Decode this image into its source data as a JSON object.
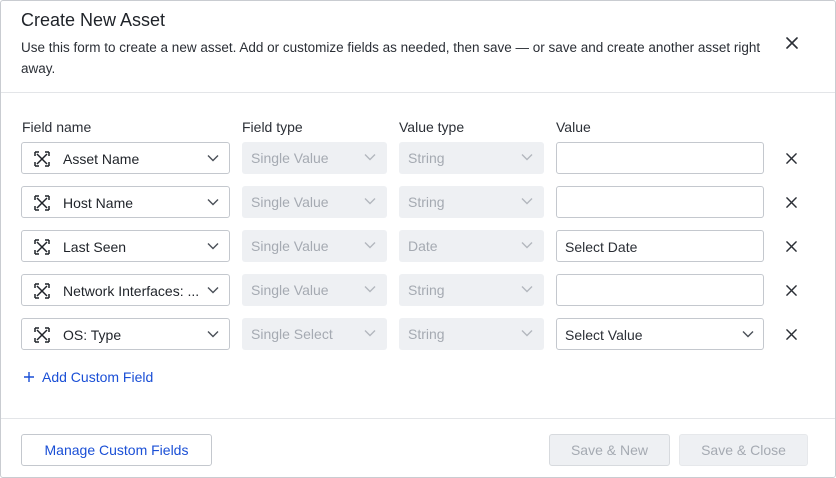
{
  "dialog": {
    "title": "Create New Asset",
    "description": "Use this form to create a new asset. Add or customize fields as needed, then save — or save and create another asset right away."
  },
  "columns": {
    "field_name": "Field name",
    "field_type": "Field type",
    "value_type": "Value type",
    "value": "Value"
  },
  "rows": [
    {
      "field": "Asset Name",
      "field_type": "Single Value",
      "value_type": "String",
      "value": "",
      "value_kind": "text"
    },
    {
      "field": "Host Name",
      "field_type": "Single Value",
      "value_type": "String",
      "value": "",
      "value_kind": "text"
    },
    {
      "field": "Last Seen",
      "field_type": "Single Value",
      "value_type": "Date",
      "value": "Select Date",
      "value_kind": "date"
    },
    {
      "field": "Network Interfaces: ...",
      "field_type": "Single Value",
      "value_type": "String",
      "value": "",
      "value_kind": "text"
    },
    {
      "field": "OS: Type",
      "field_type": "Single Select",
      "value_type": "String",
      "value": "Select Value",
      "value_kind": "select"
    }
  ],
  "add_custom_field_label": "Add Custom Field",
  "footer": {
    "manage_label": "Manage Custom Fields",
    "save_new_label": "Save & New",
    "save_close_label": "Save & Close"
  },
  "icons": {
    "close": "close-icon",
    "field": "expand-arrows-icon",
    "chevron": "chevron-down-icon",
    "add": "plus-icon"
  },
  "colors": {
    "link": "#1a4fd6",
    "disabled_bg": "#eef0f3",
    "disabled_text": "#a5aab2",
    "border": "#c4c8ce"
  }
}
